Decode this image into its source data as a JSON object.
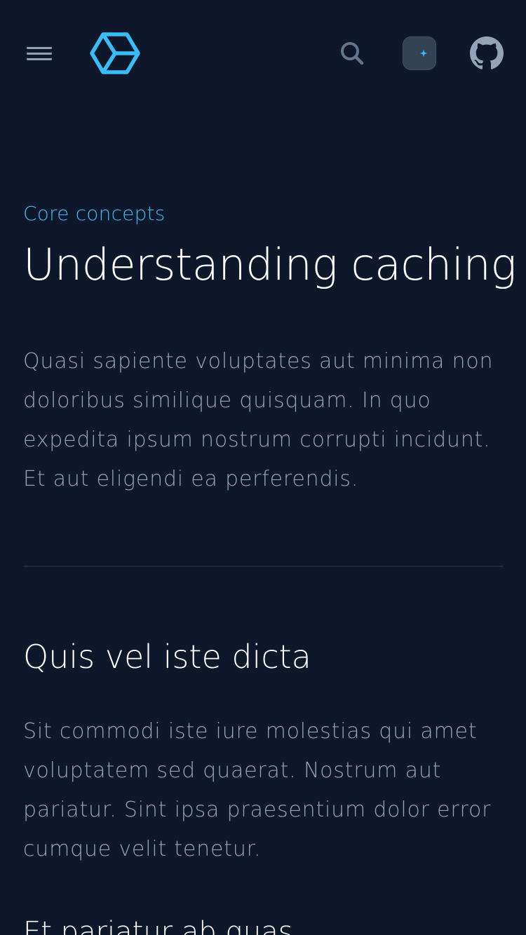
{
  "header": {
    "menu_icon": "hamburger-menu-icon",
    "logo_icon": "hexagon-logo-icon",
    "search_icon": "search-icon",
    "theme_icon": "moon-sparkle-icon",
    "github_icon": "github-icon"
  },
  "article": {
    "eyebrow": "Core concepts",
    "title": "Understanding caching",
    "lead": "Quasi sapiente voluptates aut minima non doloribus similique quisquam. In quo expedita ipsum nostrum corrupti incidunt. Et aut eligendi ea perferendis.",
    "section1": {
      "heading": "Quis vel iste dicta",
      "body": "Sit commodi iste iure molestias qui amet voluptatem sed quaerat. Nostrum aut pariatur. Sint ipsa praesentium dolor error cumque velit tenetur."
    },
    "section2": {
      "heading": "Et pariatur ab quas"
    }
  },
  "colors": {
    "background": "#0f172a",
    "accent": "#38bdf8",
    "text_muted": "#94a3b8",
    "heading": "#ffffff",
    "divider": "#1e293b"
  }
}
